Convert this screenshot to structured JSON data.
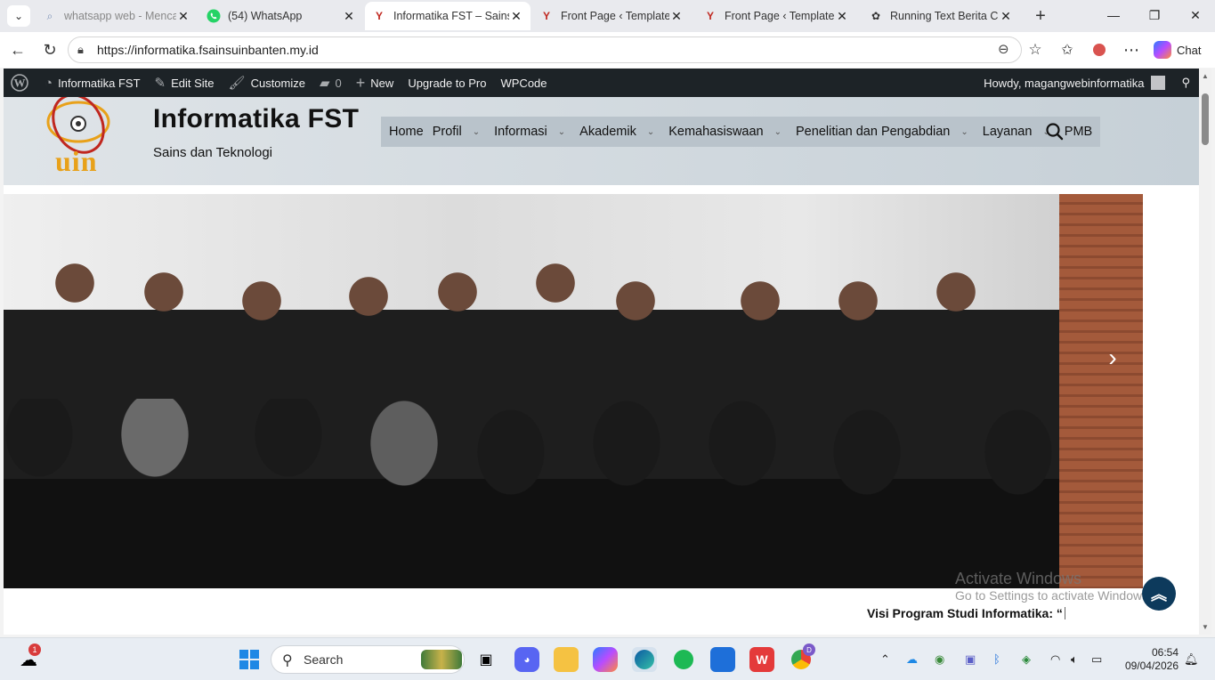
{
  "browser": {
    "tabs": [
      {
        "title": "whatsapp web - Mencari",
        "icon": "search-icon"
      },
      {
        "title": "(54) WhatsApp",
        "icon": "whatsapp-icon"
      },
      {
        "title": "Informatika FST – Sains d",
        "icon": "site-favicon-icon",
        "active": true
      },
      {
        "title": "Front Page ‹ Template ‹ I",
        "icon": "site-favicon-icon"
      },
      {
        "title": "Front Page ‹ Template ‹ I",
        "icon": "site-favicon-icon"
      },
      {
        "title": "Running Text Berita CSS",
        "icon": "chatgpt-icon"
      }
    ],
    "url": "https://informatika.fsainsuinbanten.my.id",
    "chat_label": "Chat"
  },
  "wp_admin_bar": {
    "site_name": "Informatika FST",
    "edit_site": "Edit Site",
    "customize": "Customize",
    "comments_count": "0",
    "new_label": "New",
    "upgrade": "Upgrade to Pro",
    "wpcode": "WPCode",
    "howdy": "Howdy, magangwebinformatika"
  },
  "site": {
    "title": "Informatika FST",
    "tagline": "Sains dan Teknologi",
    "logo_text": "uin",
    "nav": [
      {
        "label": "Home",
        "has_dropdown": false
      },
      {
        "label": "Profil",
        "has_dropdown": true
      },
      {
        "label": "Informasi",
        "has_dropdown": true
      },
      {
        "label": "Akademik",
        "has_dropdown": true
      },
      {
        "label": "Kemahasiswaan",
        "has_dropdown": true
      },
      {
        "label": "Penelitian dan Pengabdian",
        "has_dropdown": true
      },
      {
        "label": "Layanan",
        "has_dropdown": true
      },
      {
        "label": "PMB",
        "has_dropdown": false
      }
    ],
    "ticker_text": "Visi Program Studi Informatika: “"
  },
  "windows_notice": {
    "title": "Activate Windows",
    "subtitle": "Go to Settings to activate Windows."
  },
  "taskbar": {
    "search_placeholder": "Search",
    "weather_badge": "1",
    "profile_badge": "D",
    "time": "06:54",
    "date": "09/04/2026"
  },
  "colors": {
    "wp_bar": "#1d2327",
    "nav_bg": "#b9c3cb",
    "back_to_top": "#0d3a5c",
    "logo_red": "#c0271f",
    "logo_gold": "#e8a11a"
  }
}
